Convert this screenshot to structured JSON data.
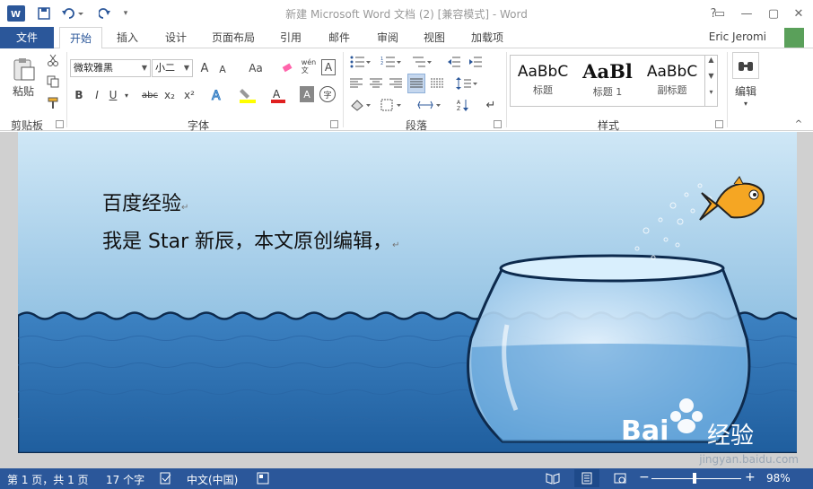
{
  "titlebar": {
    "title": "新建 Microsoft Word 文档 (2) [兼容模式] - Word",
    "window_controls": [
      "?",
      "▭",
      "—",
      "▢",
      "✕"
    ]
  },
  "tabs": {
    "file": "文件",
    "items": [
      "开始",
      "插入",
      "设计",
      "页面布局",
      "引用",
      "邮件",
      "审阅",
      "视图",
      "加载项"
    ],
    "active": "开始",
    "user": "Eric Jeromi"
  },
  "ribbon": {
    "clipboard": {
      "paste": "粘贴",
      "label": "剪贴板"
    },
    "font": {
      "family": "微软雅黑",
      "size": "小二",
      "label": "字体",
      "bold": "B",
      "italic": "I",
      "underline": "U",
      "strike": "abc",
      "subscript": "x₂",
      "superscript": "x²",
      "grow": "A",
      "shrink": "A",
      "case": "Aa",
      "pinyin": "wén\n文",
      "border_char": "A",
      "circle_char": "字",
      "accent_color": "#2b579a",
      "highlight_color": "#ffff00",
      "font_color": "#e02020"
    },
    "paragraph": {
      "label": "段落"
    },
    "styles": {
      "label": "样式",
      "items": [
        {
          "sample": "AaBbC",
          "name": "标题"
        },
        {
          "sample": "AaBl",
          "name": "标题 1"
        },
        {
          "sample": "AaBbC",
          "name": "副标题"
        }
      ]
    },
    "editing": {
      "label": "编辑"
    }
  },
  "document": {
    "line1": "百度经验",
    "line2": "我是 Star 新辰，本文原创编辑，",
    "paragraph_mark": "↵",
    "watermark_brand": "Bai",
    "watermark_cn": "经验",
    "watermark_url": "jingyan.baidu.com"
  },
  "statusbar": {
    "page": "第 1 页，共 1 页",
    "words": "17 个字",
    "language": "中文(中国)",
    "zoom": "98%",
    "zoom_level": 0.98
  },
  "colors": {
    "brand": "#2b579a",
    "sky_top": "#cfe7f6",
    "sky_bottom": "#6aa9d6",
    "sea": "#2c6fae",
    "fish": "#f5a623"
  }
}
